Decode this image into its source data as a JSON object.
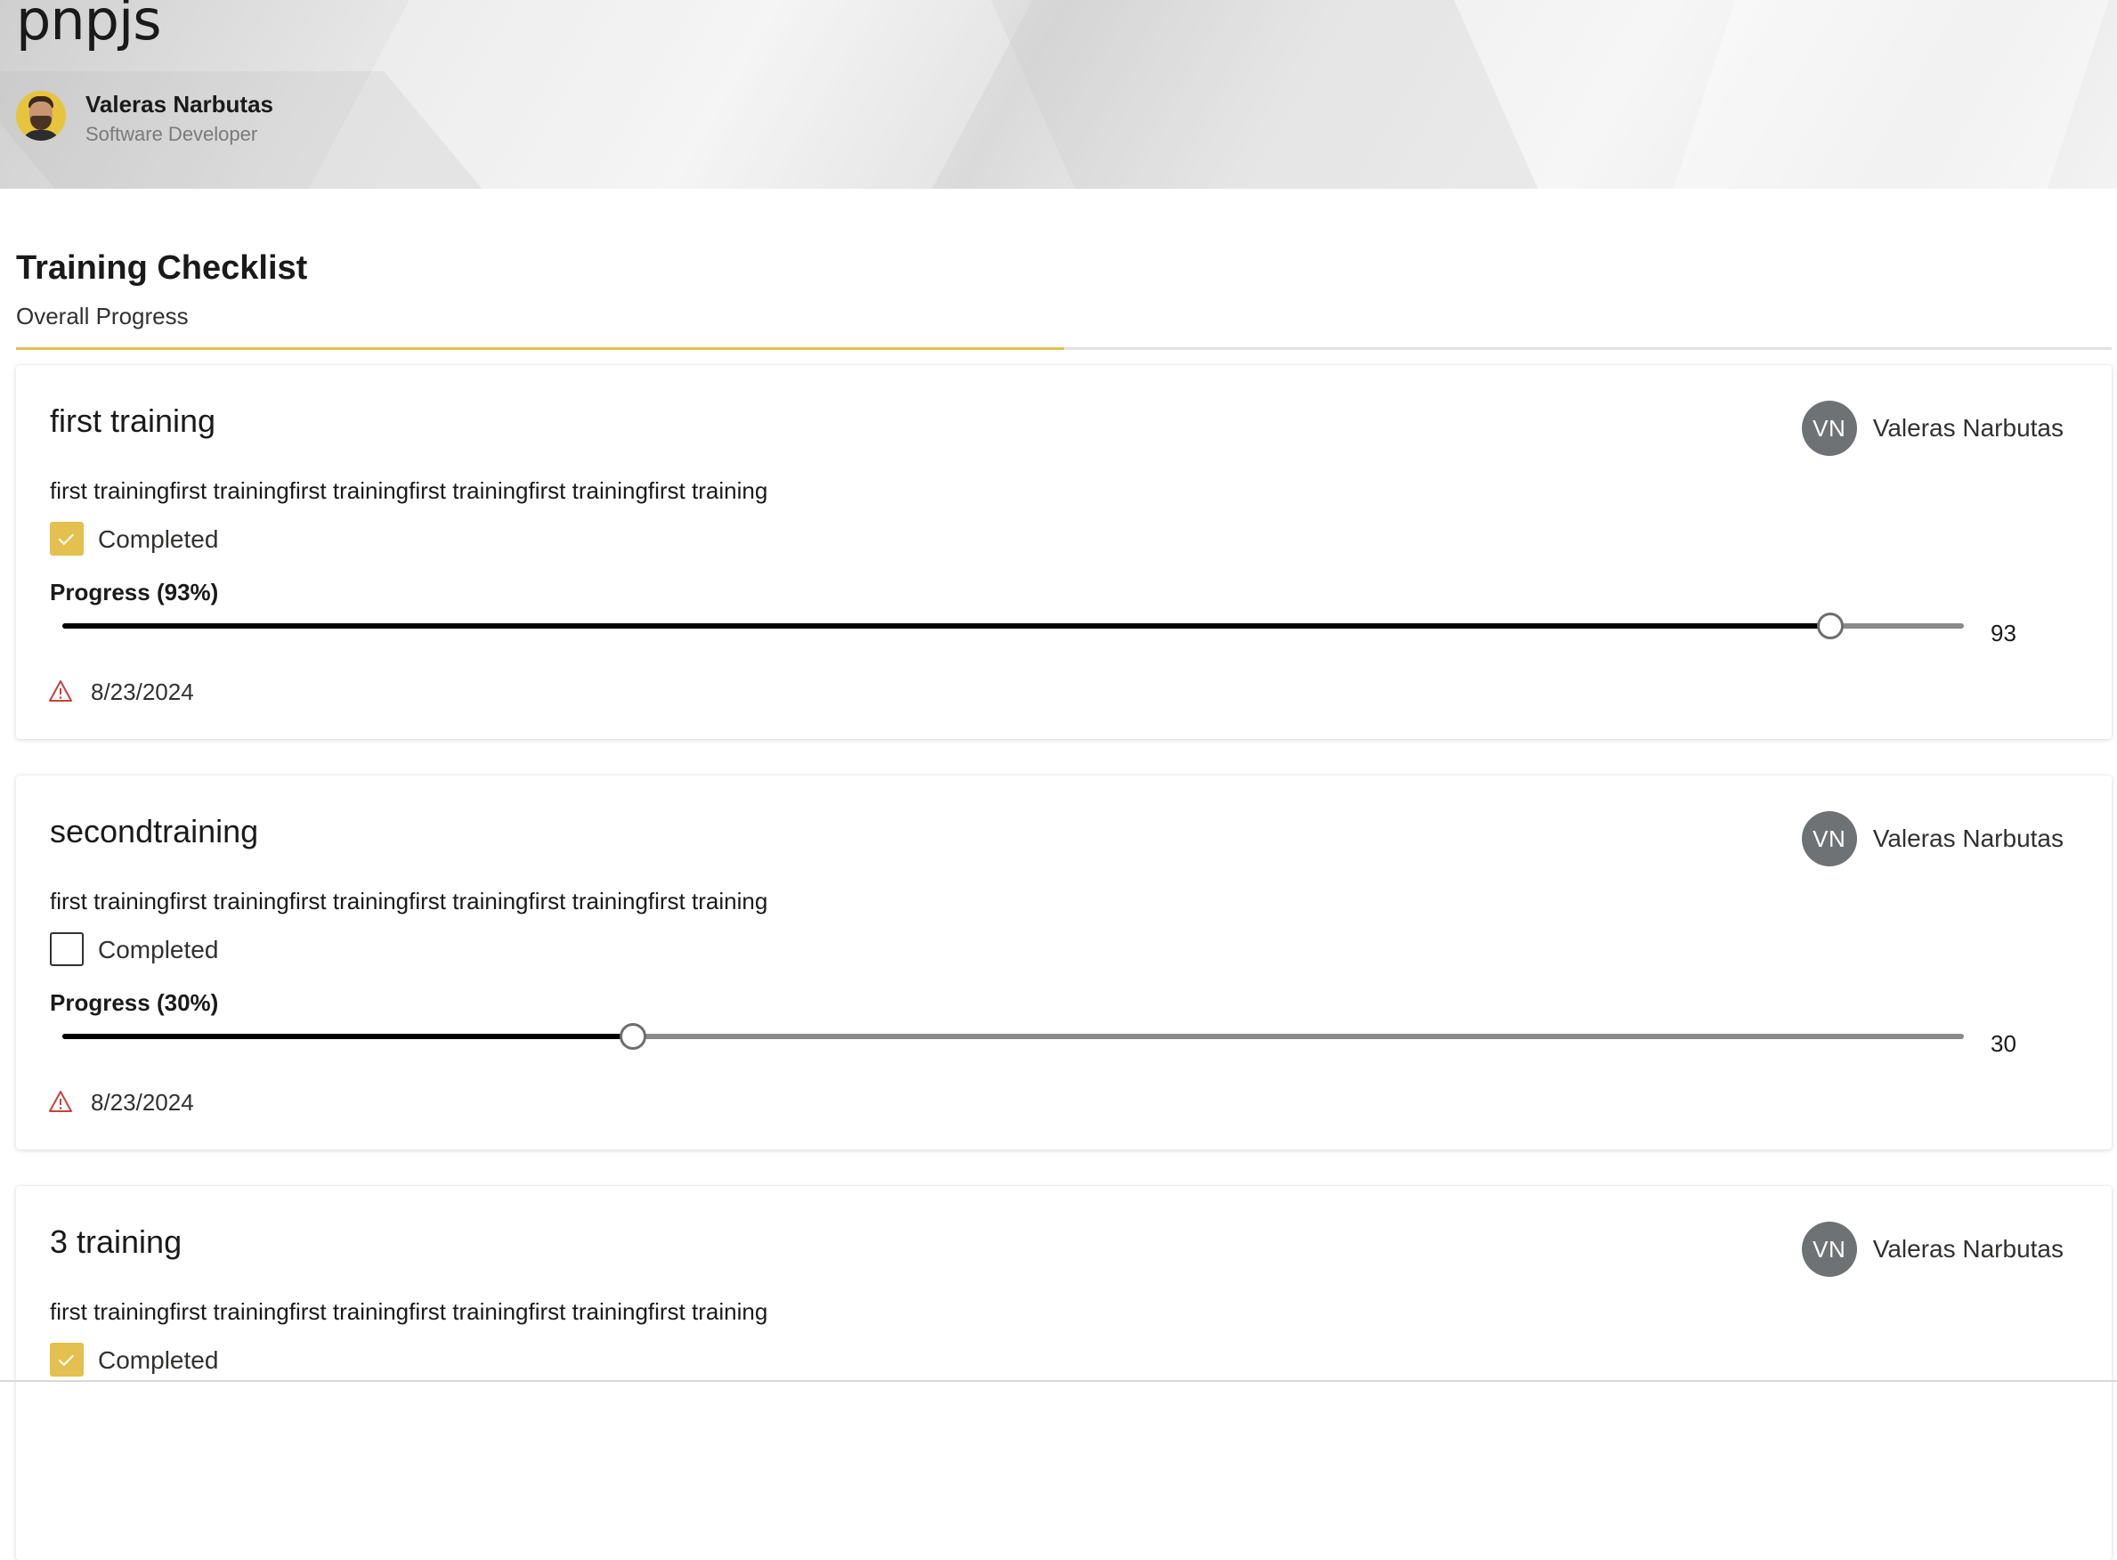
{
  "header": {
    "site_title": "pnpjs",
    "author_name": "Valeras Narbutas",
    "author_role": "Software Developer"
  },
  "checklist": {
    "title": "Training Checklist",
    "overall_label": "Overall Progress",
    "overall_progress_fraction": 0.5,
    "accent_color": "#e3c04f"
  },
  "trainings": [
    {
      "title": "first training",
      "assignee_initials": "VN",
      "assignee_name": "Valeras Narbutas",
      "description": "first trainingfirst trainingfirst trainingfirst trainingfirst trainingfirst training",
      "completed_label": "Completed",
      "completed": true,
      "progress_label": "Progress (93%)",
      "progress_value": 93,
      "progress_value_text": "93",
      "due_date": "8/23/2024",
      "due_icon": "warning-icon"
    },
    {
      "title": "secondtraining",
      "assignee_initials": "VN",
      "assignee_name": "Valeras Narbutas",
      "description": "first trainingfirst trainingfirst trainingfirst trainingfirst trainingfirst training",
      "completed_label": "Completed",
      "completed": false,
      "progress_label": "Progress (30%)",
      "progress_value": 30,
      "progress_value_text": "30",
      "due_date": "8/23/2024",
      "due_icon": "warning-icon"
    },
    {
      "title": "3 training",
      "assignee_initials": "VN",
      "assignee_name": "Valeras Narbutas",
      "description": "first trainingfirst trainingfirst trainingfirst trainingfirst trainingfirst training",
      "completed_label": "Completed",
      "completed": true
    }
  ]
}
